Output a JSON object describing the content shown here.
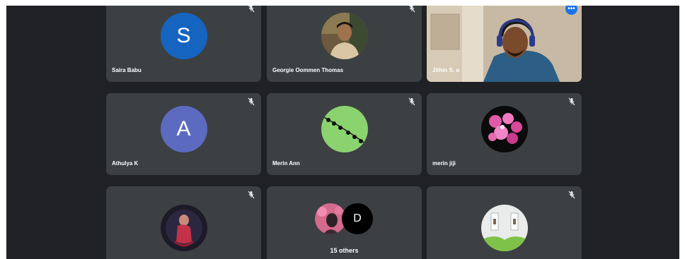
{
  "participants": [
    {
      "name": "Saira Babu",
      "avatar_letter": "S",
      "avatar_color": "#1565c0",
      "muted": true
    },
    {
      "name": "Georgie Oommen Thomas",
      "avatar_type": "photo",
      "muted": true
    },
    {
      "name": "Jithin S. o",
      "avatar_type": "video",
      "active": true
    },
    {
      "name": "Athulya K",
      "avatar_letter": "A",
      "avatar_color": "#5c6bc0",
      "muted": true
    },
    {
      "name": "Merin Ann",
      "avatar_type": "photo",
      "muted": true
    },
    {
      "name": "merin jiji",
      "avatar_type": "photo",
      "muted": true
    },
    {
      "name": "",
      "avatar_type": "photo",
      "muted": true
    },
    {
      "name": "",
      "avatar_type": "photo",
      "muted": true
    }
  ],
  "others_tile": {
    "count_label": "15 others",
    "mini_letter": "D"
  },
  "icons": {
    "mic_off": "mic-off-icon",
    "more": "more-options-icon"
  },
  "colors": {
    "background": "#202124",
    "tile": "#3c4043",
    "active_outline": "#8ab4f8",
    "more_button": "#1a73e8"
  }
}
